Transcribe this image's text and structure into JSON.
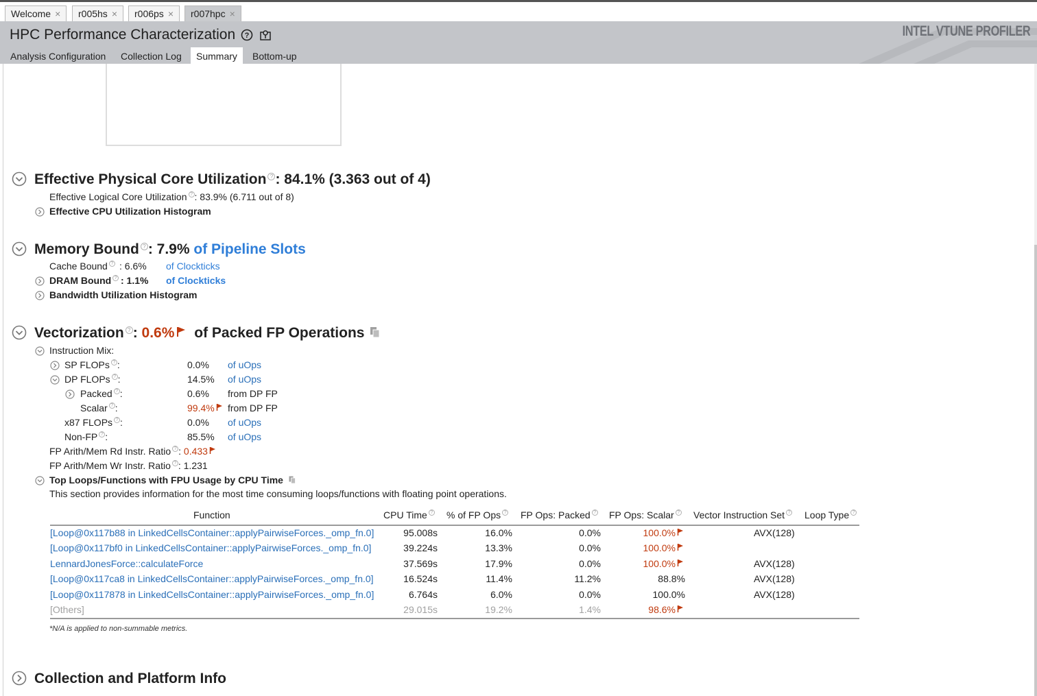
{
  "tabs": [
    {
      "label": "Welcome",
      "close": "×"
    },
    {
      "label": "r005hs",
      "close": "×"
    },
    {
      "label": "r006ps",
      "close": "×"
    },
    {
      "label": "r007hpc",
      "close": "×"
    }
  ],
  "header": {
    "title": "HPC Performance Characterization",
    "brand": "INTEL VTUNE PROFILER"
  },
  "subtabs": [
    "Analysis Configuration",
    "Collection Log",
    "Summary",
    "Bottom-up"
  ],
  "core": {
    "title": "Effective Physical Core Utilization",
    "value": ": 84.1% (3.363 out of 4)",
    "logical_label": "Effective Logical Core Utilization",
    "logical_value": ": 83.9% (6.711 out of 8)",
    "histogram": "Effective CPU Utilization Histogram"
  },
  "memory": {
    "title": "Memory Bound",
    "value": ": 7.9%",
    "unit": "of Pipeline Slots",
    "cache_label": "Cache Bound",
    "cache_value": ":   6.6%",
    "cache_unit": "of Clockticks",
    "dram_label": "DRAM Bound",
    "dram_value": ": 1.1%",
    "dram_unit": "of Clockticks",
    "bw_histogram": "Bandwidth Utilization Histogram"
  },
  "vector": {
    "title": "Vectorization",
    "colon": ":",
    "value": "0.6%",
    "unit": "of Packed FP Operations",
    "mix_label": "Instruction Mix:",
    "rows": [
      {
        "label": "SP FLOPs",
        "value": "0.0%",
        "unit": "of uOps"
      },
      {
        "label": "DP FLOPs",
        "value": "14.5%",
        "unit": "of uOps"
      },
      {
        "label": "Packed",
        "value": "0.6%",
        "unit": "from DP FP"
      },
      {
        "label": "Scalar",
        "value": "99.4%",
        "unit": "from DP FP"
      },
      {
        "label": "x87 FLOPs",
        "value": "0.0%",
        "unit": "of uOps"
      },
      {
        "label": "Non-FP",
        "value": "85.5%",
        "unit": "of uOps"
      }
    ],
    "rd_label": "FP Arith/Mem Rd Instr. Ratio",
    "rd_value": "0.433",
    "wr_label": "FP Arith/Mem Wr Instr. Ratio",
    "wr_value": "1.231",
    "top_title": "Top Loops/Functions with FPU Usage by CPU Time",
    "top_desc": "This section provides information for the most time consuming loops/functions with floating point operations."
  },
  "table": {
    "headers": [
      "Function",
      "CPU Time",
      "% of FP Ops",
      "FP Ops: Packed",
      "FP Ops: Scalar",
      "Vector Instruction Set",
      "Loop Type"
    ],
    "rows": [
      {
        "func": "[Loop@0x117b88 in LinkedCellsContainer::applyPairwiseForces._omp_fn.0]",
        "cpu": "95.008s",
        "pct": "16.0%",
        "packed": "0.0%",
        "scalar": "100.0%",
        "vis": "AVX(128)",
        "flag": true
      },
      {
        "func": "[Loop@0x117bf0 in LinkedCellsContainer::applyPairwiseForces._omp_fn.0]",
        "cpu": "39.224s",
        "pct": "13.3%",
        "packed": "0.0%",
        "scalar": "100.0%",
        "vis": "",
        "flag": true
      },
      {
        "func": "LennardJonesForce::calculateForce",
        "cpu": "37.569s",
        "pct": "17.9%",
        "packed": "0.0%",
        "scalar": "100.0%",
        "vis": "AVX(128)",
        "flag": true
      },
      {
        "func": "[Loop@0x117ca8 in LinkedCellsContainer::applyPairwiseForces._omp_fn.0]",
        "cpu": "16.524s",
        "pct": "11.4%",
        "packed": "11.2%",
        "scalar": "88.8%",
        "vis": "AVX(128)",
        "flag": false
      },
      {
        "func": "[Loop@0x117878 in LinkedCellsContainer::applyPairwiseForces._omp_fn.0]",
        "cpu": "6.764s",
        "pct": "6.0%",
        "packed": "0.0%",
        "scalar": "100.0%",
        "vis": "AVX(128)",
        "flag": false
      },
      {
        "func": "[Others]",
        "cpu": "29.015s",
        "pct": "19.2%",
        "packed": "1.4%",
        "scalar": "98.6%",
        "vis": "",
        "flag": true
      }
    ],
    "footnote": "*N/A is applied to non-summable metrics."
  },
  "collection": {
    "title": "Collection and Platform Info"
  },
  "colors": {
    "header_bg": "#c3c5c9",
    "link_blue": "#2f7ed8",
    "warn_red": "#c03a0e"
  }
}
